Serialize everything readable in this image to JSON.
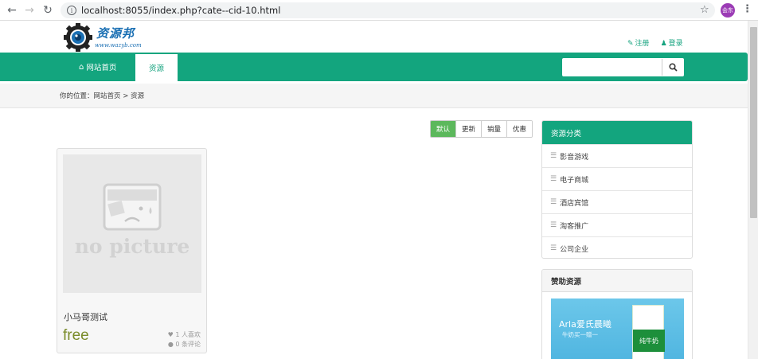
{
  "browser": {
    "url": "localhost:8055/index.php?cate--cid-10.html",
    "profile_label": "会东"
  },
  "header": {
    "logo_brand": "资源邦",
    "logo_url": "www.wazyb.com",
    "register": "注册",
    "login": "登录"
  },
  "nav": {
    "home": "网站首页",
    "active": "资源",
    "search_placeholder": ""
  },
  "breadcrumb": {
    "text": "你的位置：网站首页 > 资源"
  },
  "sort": {
    "options": [
      "默认",
      "更新",
      "销量",
      "优惠"
    ]
  },
  "product": {
    "title": "小马哥测试",
    "price": "free",
    "likes": "1 人喜欢",
    "comments": "0 条评论",
    "placeholder_text": "no picture"
  },
  "categories": {
    "title": "资源分类",
    "items": [
      "影音游戏",
      "电子商城",
      "酒店宾馆",
      "淘客推广",
      "公司企业"
    ]
  },
  "sponsor": {
    "title": "赞助资源",
    "ad_title": "Arla爱氏晨曦",
    "ad_sub": "牛奶买一赠一",
    "ad_box": "纯牛奶"
  },
  "colors": {
    "brand_green": "#13a57e",
    "sort_active": "#5cb85c",
    "price": "#7a8c2a"
  }
}
